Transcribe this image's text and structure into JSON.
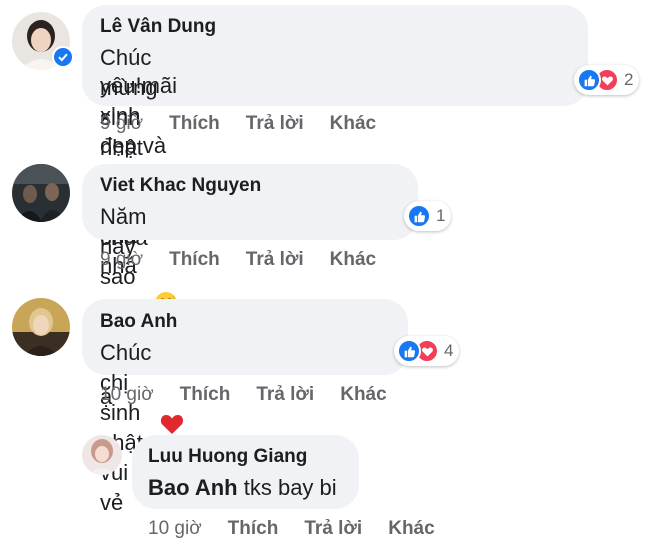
{
  "comments": [
    {
      "author": "Lê Vân Dung",
      "text_line1": "Chúc mừng sinh nhật muộn công chúa",
      "text_line2": "yêu!mãi xinh đẹp và hạnh phúc nhá nhá",
      "reaction_count": "2",
      "time": "9 giờ",
      "like": "Thích",
      "reply": "Trả lời",
      "more": "Khác"
    },
    {
      "author": "Viet Khac Nguyen",
      "text": "Năm nay sao to quá bác ạ",
      "reaction_count": "1",
      "time": "9 giờ",
      "like": "Thích",
      "reply": "Trả lời",
      "more": "Khác"
    },
    {
      "author": "Bao Anh",
      "text": "Chúc chị sinh nhật vui vẻ",
      "reaction_count": "4",
      "time": "10 giờ",
      "like": "Thích",
      "reply": "Trả lời",
      "more": "Khác"
    },
    {
      "author": "Luu Huong Giang",
      "mention": "Bao Anh",
      "text": " tks bay bi",
      "time": "10 giờ",
      "like": "Thích",
      "reply": "Trả lời",
      "more": "Khác"
    }
  ],
  "colors": {
    "bubble": "#f0f2f5",
    "like_blue": "#1877f2",
    "love_red": "#f33e58",
    "meta_gray": "#65676b"
  },
  "icons": [
    "verified-badge-icon",
    "like-reaction-icon",
    "love-reaction-icon",
    "grinning-sweat-emoji-icon",
    "red-heart-emoji-icon"
  ]
}
